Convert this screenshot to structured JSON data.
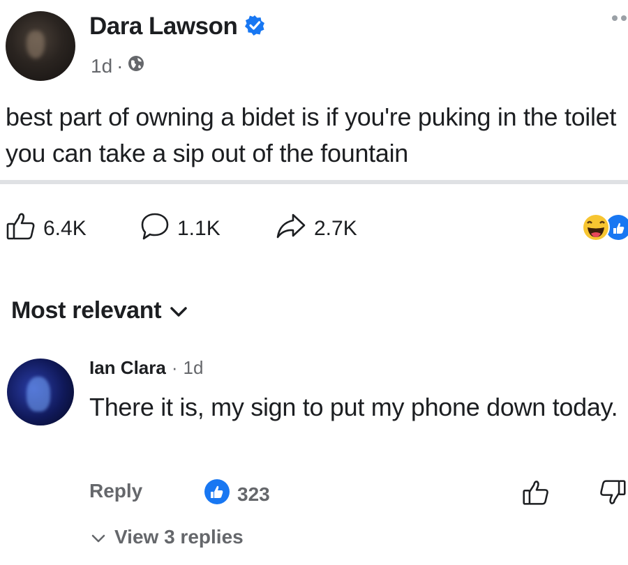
{
  "post": {
    "author": "Dara Lawson",
    "verified": true,
    "timestamp": "1d",
    "separator": "·",
    "audience_icon": "globe-icon",
    "text": "best part of owning a bidet is if you're puking in the toilet you can take a sip out of the fountain"
  },
  "actions": {
    "likes": "6.4K",
    "comments": "1.1K",
    "shares": "2.7K"
  },
  "sort": {
    "label": "Most relevant"
  },
  "comment": {
    "author": "Ian Clara",
    "separator": "·",
    "timestamp": "1d",
    "text": "There it is, my sign to put my phone down today.",
    "reply_label": "Reply",
    "like_count": "323",
    "view_replies_label": "View 3 replies"
  },
  "colors": {
    "accent": "#1877f2",
    "text": "#1c1e21",
    "secondary": "#65676b"
  }
}
